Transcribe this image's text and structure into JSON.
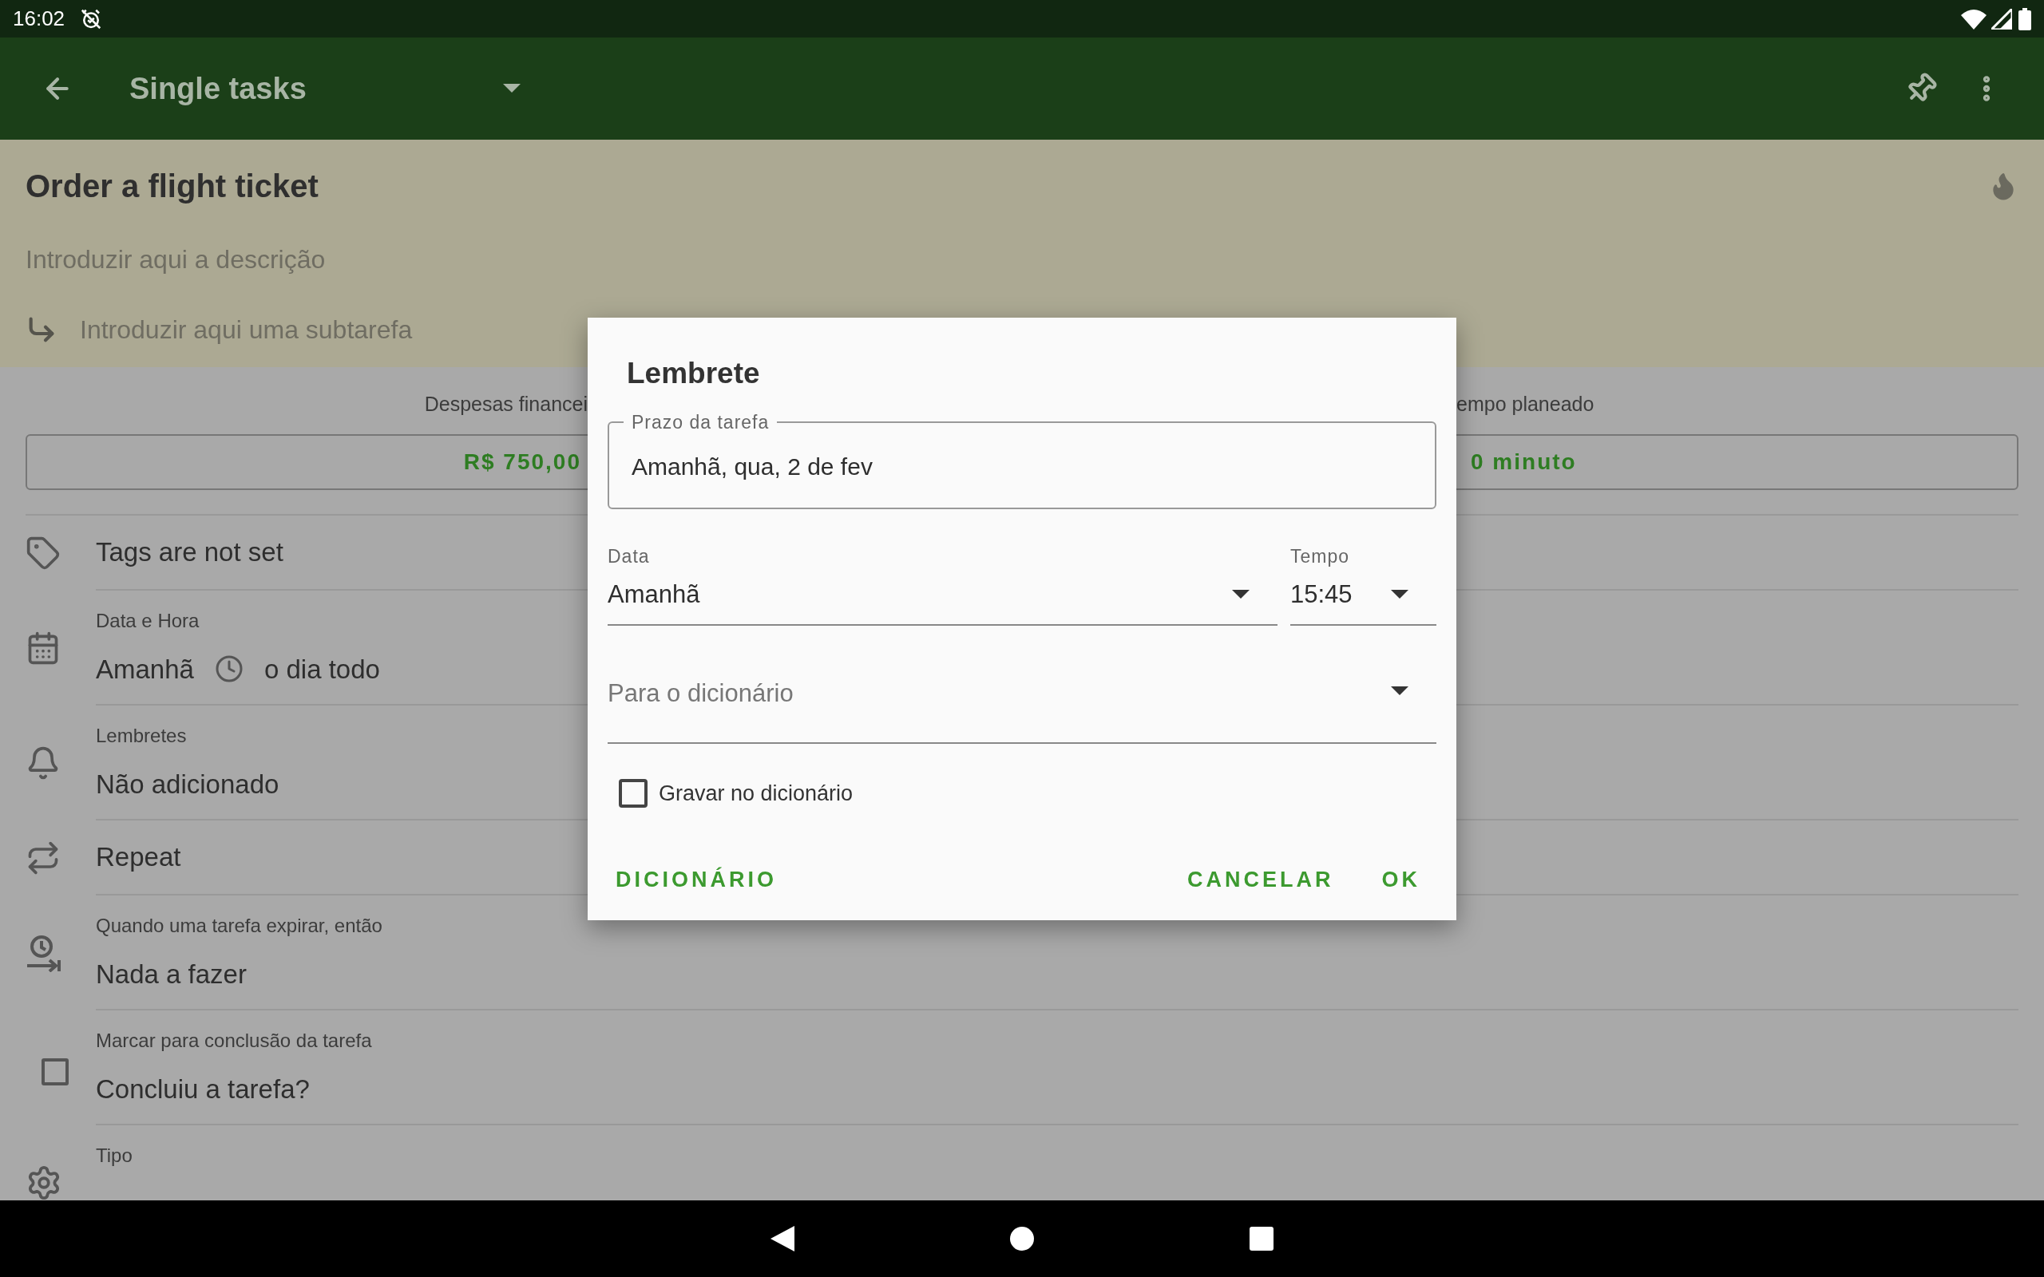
{
  "status_bar": {
    "time": "16:02"
  },
  "app_bar": {
    "title": "Single tasks"
  },
  "task": {
    "title": "Order a flight ticket",
    "description_placeholder": "Introduzir aqui a descrição",
    "subtask_placeholder": "Introduzir aqui uma subtarefa"
  },
  "metrics": [
    {
      "label": "Despesas financei",
      "value": "R$ 750,00"
    },
    {
      "label": "empo planeado",
      "value": "0 minuto"
    }
  ],
  "rows": [
    {
      "kind": "plain",
      "value": "Tags are not set"
    },
    {
      "kind": "datetime",
      "label": "Data e Hora",
      "date": "Amanhã",
      "time": "o dia todo"
    },
    {
      "kind": "labeled",
      "label": "Lembretes",
      "value": "Não adicionado"
    },
    {
      "kind": "plain",
      "value": "Repeat"
    },
    {
      "kind": "labeled",
      "label": "Quando uma tarefa expirar, então",
      "value": "Nada a fazer"
    },
    {
      "kind": "checkbox",
      "label": "Marcar para conclusão da tarefa",
      "value": "Concluiu a tarefa?",
      "checked": false
    },
    {
      "kind": "labeled",
      "label": "Tipo"
    }
  ],
  "dialog": {
    "title": "Lembrete",
    "deadline_field": {
      "label": "Prazo da tarefa",
      "value": "Amanhã, qua, 2 de fev"
    },
    "date_field": {
      "label": "Data",
      "value": "Amanhã"
    },
    "time_field": {
      "label": "Tempo",
      "value": "15:45"
    },
    "dictionary_field": {
      "placeholder": "Para o dicionário"
    },
    "save_checkbox": {
      "label": "Gravar no dicionário",
      "checked": false
    },
    "buttons": [
      "DICIONÁRIO",
      "CANCELAR",
      "OK"
    ]
  }
}
